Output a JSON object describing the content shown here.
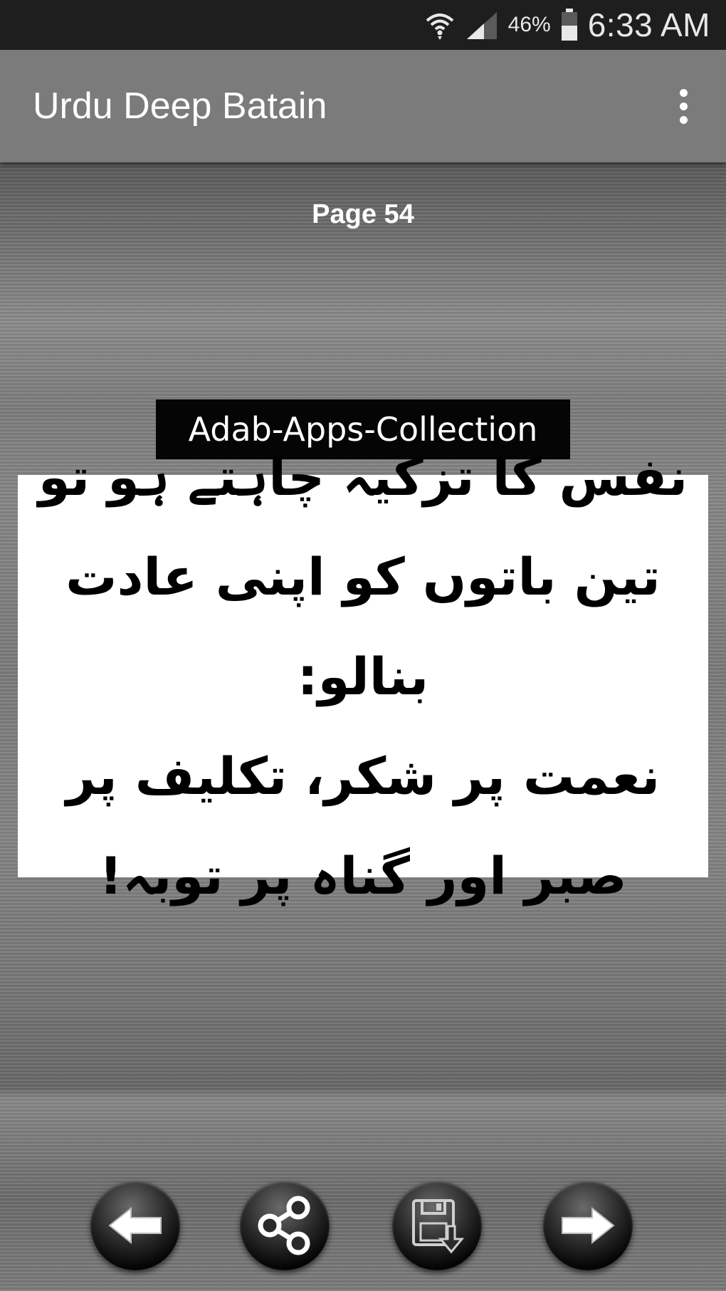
{
  "status_bar": {
    "battery_percent": "46%",
    "time": "6:33 AM",
    "icons": [
      "wifi-icon",
      "signal-icon",
      "battery-icon"
    ]
  },
  "action_bar": {
    "title": "Urdu Deep Batain",
    "overflow_icon": "more-vert-icon"
  },
  "content": {
    "page_label": "Page 54",
    "watermark": "Adab-Apps-Collection",
    "quote_lines": [
      "نفس کا تزکیہ چاہتے ہو تو",
      "تین باتوں کو اپنی عادت بنالو:",
      "نعمت پر شکر، تکلیف پر صبر اور گناہ پر توبہ!"
    ]
  },
  "bottom_buttons": [
    {
      "name": "previous-button",
      "icon": "arrow-left-icon"
    },
    {
      "name": "share-button",
      "icon": "share-icon"
    },
    {
      "name": "save-button",
      "icon": "save-icon"
    },
    {
      "name": "next-button",
      "icon": "arrow-right-icon"
    }
  ],
  "colors": {
    "status_bar": "#1e1e1e",
    "action_bar": "#7b7b7b",
    "watermark_bg": "#050505",
    "card_bg": "#ffffff"
  }
}
